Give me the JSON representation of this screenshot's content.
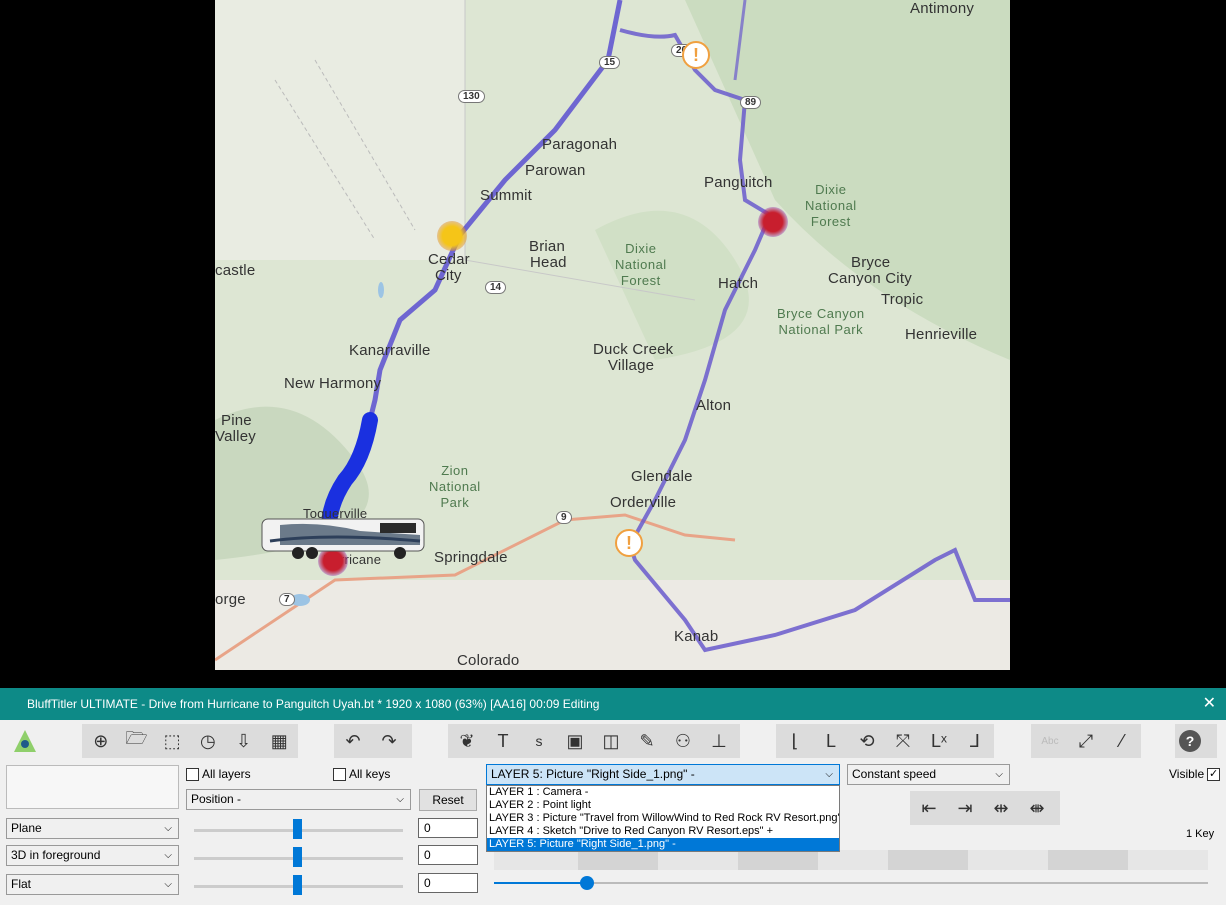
{
  "map": {
    "places": [
      {
        "name": "Antimony"
      },
      {
        "name": "Paragonah"
      },
      {
        "name": "Parowan"
      },
      {
        "name": "Summit"
      },
      {
        "name": "Panguitch"
      },
      {
        "name": "Brian"
      },
      {
        "name": "Head"
      },
      {
        "name": "Cedar"
      },
      {
        "name": "City"
      },
      {
        "name": "castle"
      },
      {
        "name": "Bryce"
      },
      {
        "name": "Canyon City"
      },
      {
        "name": "Tropic"
      },
      {
        "name": "Hatch"
      },
      {
        "name": "Henrieville"
      },
      {
        "name": "Kanarraville"
      },
      {
        "name": "Duck Creek"
      },
      {
        "name": "Village"
      },
      {
        "name": "New Harmony"
      },
      {
        "name": "Pine"
      },
      {
        "name": "Valley"
      },
      {
        "name": "Alton"
      },
      {
        "name": "Glendale"
      },
      {
        "name": "Orderville"
      },
      {
        "name": "Springdale"
      },
      {
        "name": "orge"
      },
      {
        "name": "Kanab"
      },
      {
        "name": "Colorado"
      },
      {
        "name": "Toquerville"
      },
      {
        "name": "Hurricane"
      }
    ],
    "parks": [
      {
        "line1": "Dixie",
        "line2": "National",
        "line3": "Forest"
      },
      {
        "line1": "Dixie",
        "line2": "National",
        "line3": "Forest"
      },
      {
        "line1": "Bryce Canyon",
        "line2": "National Park",
        "line3": ""
      },
      {
        "line1": "Zion",
        "line2": "National",
        "line3": "Park"
      }
    ],
    "shields": [
      "130",
      "15",
      "89",
      "14",
      "9",
      "7",
      "20"
    ]
  },
  "window": {
    "title": "BluffTitler ULTIMATE  - Drive from Hurricane to Panguitch Uyah.bt * 1920 x 1080 (63%) [AA16] 00:09 Editing",
    "close": "✕"
  },
  "toolbar": {
    "logo_icon": "eye-logo-icon",
    "group1": [
      "add-icon",
      "open-folder-icon",
      "select-frame-icon",
      "clock-icon",
      "import-folder-icon",
      "film-icon"
    ],
    "group2": [
      "undo-icon",
      "redo-icon"
    ],
    "group3": [
      "blob-icon",
      "text-icon",
      "s-icon",
      "image-icon",
      "cube-icon",
      "pen-icon",
      "particles-icon",
      "plot-icon"
    ],
    "group4": [
      "layer-a-icon",
      "layer-b-icon",
      "link-icon",
      "shrink-icon",
      "l-x-icon",
      "l-corner-icon"
    ],
    "group5": [
      "text-grayed-icon",
      "picture-expand-icon",
      "wand-icon"
    ],
    "help": "?"
  },
  "controls": {
    "all_layers": "All layers",
    "all_keys": "All keys",
    "property": "Position -",
    "reset": "Reset",
    "plane": "Plane",
    "foreground": "3D in foreground",
    "flat": "Flat",
    "values": [
      "0",
      "0",
      "0"
    ],
    "layer_selected": "LAYER   5: Picture \"Right Side_1.png\" -",
    "speed": "Constant speed",
    "visible": "Visible",
    "keys": "1 Key",
    "layers": [
      "LAYER  1  : Camera -",
      "LAYER  2  : Point light",
      "LAYER  3  : Picture \"Travel from WillowWind to Red Rock RV Resort.png\" -",
      "LAYER  4  : Sketch \"Drive to Red Canyon RV Resort.eps\" +",
      "LAYER   5: Picture \"Right Side_1.png\" -"
    ],
    "key_nav": [
      "⇤",
      "⇥",
      "⇹",
      "⇼"
    ],
    "progress": 0.13
  }
}
